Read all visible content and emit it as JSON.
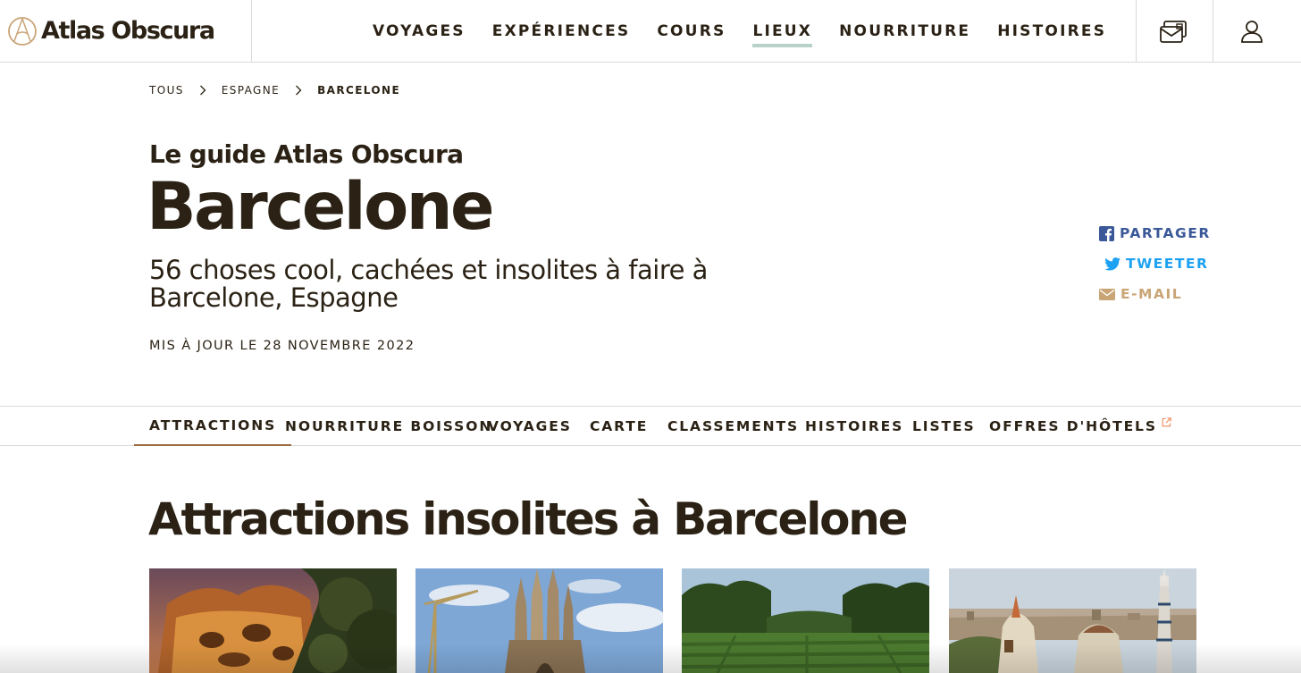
{
  "brand": {
    "name": "Atlas Obscura"
  },
  "nav": {
    "items": [
      {
        "label": "VOYAGES"
      },
      {
        "label": "EXPÉRIENCES"
      },
      {
        "label": "COURS"
      },
      {
        "label": "LIEUX"
      },
      {
        "label": "NOURRITURE"
      },
      {
        "label": "HISTOIRES"
      }
    ],
    "active": "LIEUX"
  },
  "icons": {
    "mail": "mail-icon",
    "user": "user-icon"
  },
  "breadcrumb": [
    {
      "label": "TOUS"
    },
    {
      "label": "ESPAGNE"
    },
    {
      "label": "BARCELONE"
    }
  ],
  "header": {
    "kicker": "Le guide Atlas Obscura",
    "title": "Barcelone",
    "subtitle": "56 choses cool, cachées et insolites à faire à Barcelone, Espagne",
    "updated": "MIS À JOUR LE 28 NOVEMBRE 2022"
  },
  "share": {
    "facebook": "PARTAGER",
    "twitter": "TWEETER",
    "email": "E-MAIL"
  },
  "tabs": [
    {
      "label": "ATTRACTIONS"
    },
    {
      "label": "NOURRITURE BOISSON"
    },
    {
      "label": "VOYAGES"
    },
    {
      "label": "CARTE"
    },
    {
      "label": "CLASSEMENTS"
    },
    {
      "label": "HISTOIRES"
    },
    {
      "label": "LISTES"
    },
    {
      "label": "OFFRES D'HÔTELS"
    }
  ],
  "active_tab": "ATTRACTIONS",
  "section": {
    "title": "Attractions insolites à Barcelone"
  },
  "colors": {
    "text": "#2b2215",
    "nav_underline": "#b7d2c8",
    "tab_underline": "#9b6e42",
    "facebook": "#3b5998",
    "twitter": "#1da1f2",
    "email": "#c9a576",
    "external_link": "#f08a5d",
    "logo_accent": "#c9a576"
  }
}
